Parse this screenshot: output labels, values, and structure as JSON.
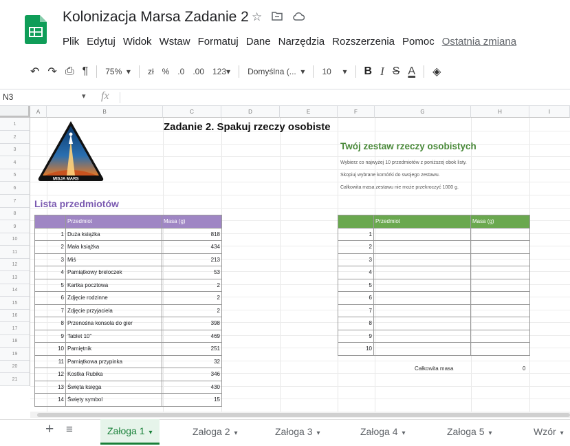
{
  "header": {
    "title": "Kolonizacja Marsa Zadanie 2",
    "title_icons": [
      "star-icon",
      "folder-move-icon",
      "cloud-status-icon"
    ],
    "menu": [
      "Plik",
      "Edytuj",
      "Widok",
      "Wstaw",
      "Formatuj",
      "Dane",
      "Narzędzia",
      "Rozszerzenia",
      "Pomoc"
    ],
    "last_edit": "Ostatnia zmiana"
  },
  "toolbar": {
    "undo": "↶",
    "redo": "↷",
    "print": "⎙",
    "paint": "¶",
    "zoom": "75%",
    "currency": "zł",
    "percent": "%",
    "dec_less": ".0",
    "dec_more": ".00",
    "format_more": "123",
    "font": "Domyślna (...",
    "font_size": "10",
    "bold": "B",
    "italic": "I",
    "strike": "S",
    "text_color": "A",
    "fill": "◈"
  },
  "formula_bar": {
    "name_box": "N3",
    "fx": "fx"
  },
  "columns": [
    "A",
    "B",
    "C",
    "D",
    "E",
    "F",
    "G",
    "H",
    "I"
  ],
  "rows": [
    "1",
    "2",
    "3",
    "4",
    "5",
    "6",
    "7",
    "8",
    "9",
    "10",
    "11",
    "12",
    "13",
    "14",
    "15",
    "16",
    "17",
    "18",
    "19",
    "20",
    "21"
  ],
  "sheet": {
    "heading": "Zadanie 2. Spakuj rzeczy osobiste",
    "logo_text": "MISJA MARS",
    "lista_title": "Lista przedmiotów",
    "zestaw_title": "Twój zestaw rzeczy osobistych",
    "instructions": [
      "Wybierz co najwyżej 10 przedmiotów z poniższej obok listy.",
      "Skopiuj wybrane komórki do swojego zestawu.",
      "Całkowita masa zestawu nie może przekroczyć 1000 g."
    ],
    "item_table": {
      "headers": [
        "Przedmiot",
        "Masa (g)"
      ],
      "rows": [
        {
          "n": "1",
          "name": "Duża książka",
          "mass": "818"
        },
        {
          "n": "2",
          "name": "Mała książka",
          "mass": "434"
        },
        {
          "n": "3",
          "name": "Miś",
          "mass": "213"
        },
        {
          "n": "4",
          "name": "Pamiątkowy breloczek",
          "mass": "53"
        },
        {
          "n": "5",
          "name": "Kartka pocztowa",
          "mass": "2"
        },
        {
          "n": "6",
          "name": "Zdjęcie rodzinne",
          "mass": "2"
        },
        {
          "n": "7",
          "name": "Zdjęcie przyjaciela",
          "mass": "2"
        },
        {
          "n": "8",
          "name": "Przenośna konsola do gier",
          "mass": "398"
        },
        {
          "n": "9",
          "name": "Tablet 10\"",
          "mass": "469"
        },
        {
          "n": "10",
          "name": "Pamiętnik",
          "mass": "251"
        },
        {
          "n": "11",
          "name": "Pamiątkowa przypinka",
          "mass": "32"
        },
        {
          "n": "12",
          "name": "Kostka Rubika",
          "mass": "346"
        },
        {
          "n": "13",
          "name": "Święta księga",
          "mass": "430"
        },
        {
          "n": "14",
          "name": "Święty symbol",
          "mass": "15"
        }
      ]
    },
    "set_table": {
      "headers": [
        "Przedmiot",
        "Masa (g)"
      ],
      "rows": [
        "1",
        "2",
        "3",
        "4",
        "5",
        "6",
        "7",
        "8",
        "9",
        "10"
      ]
    },
    "total_label": "Całkowita masa",
    "total_value": "0"
  },
  "tabs": [
    {
      "label": "Załoga 1",
      "active": true
    },
    {
      "label": "Załoga 2",
      "active": false
    },
    {
      "label": "Załoga 3",
      "active": false
    },
    {
      "label": "Załoga 4",
      "active": false
    },
    {
      "label": "Załoga 5",
      "active": false
    },
    {
      "label": "Wzór",
      "active": false
    }
  ],
  "colors": {
    "sheets_green": "#0f9d58",
    "purple_header": "#9f86c4",
    "green_header": "#6aa84f",
    "tab_active_bg": "#e6f4ea",
    "tab_active_text": "#188038"
  }
}
